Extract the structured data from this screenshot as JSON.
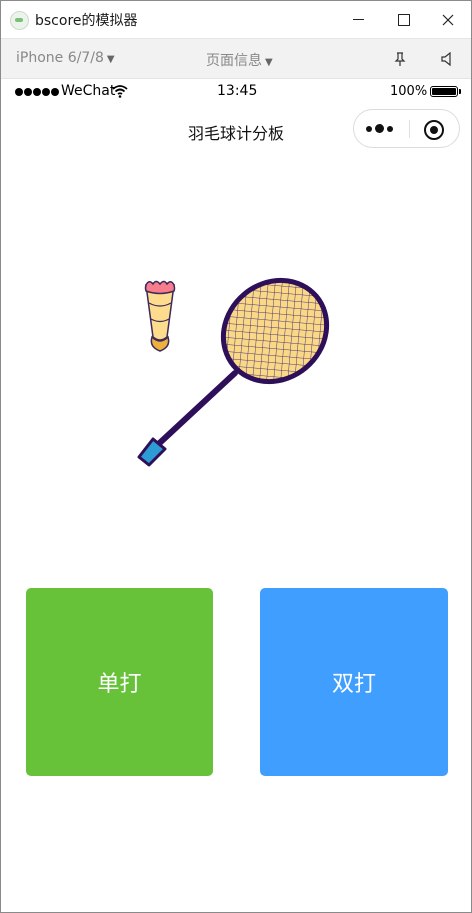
{
  "window": {
    "title": "bscore的模拟器",
    "controls": [
      "minimize",
      "maximize",
      "close"
    ]
  },
  "toolbar": {
    "device": "iPhone 6/7/8",
    "page_info": "页面信息",
    "icons": [
      "pin-icon",
      "sound-icon"
    ]
  },
  "status_bar": {
    "carrier": "WeChat",
    "time": "13:45",
    "battery": "100%",
    "battery_level": 1.0
  },
  "nav": {
    "title": "羽毛球计分板"
  },
  "main": {
    "illustration": "badminton-racket-and-shuttlecock",
    "buttons": [
      {
        "label": "单打",
        "color": "#67c23a"
      },
      {
        "label": "双打",
        "color": "#409eff"
      }
    ]
  }
}
